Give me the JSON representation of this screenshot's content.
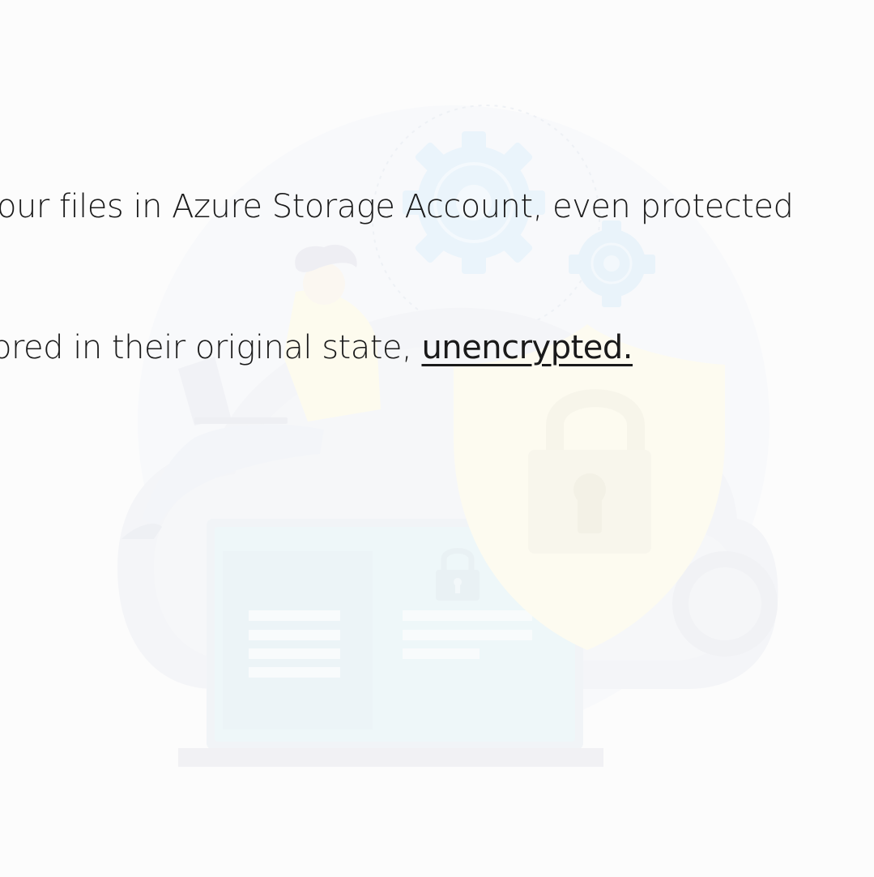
{
  "slide": {
    "line1": "our files in Azure Storage Account, even protected",
    "line2_prefix": "ored in their original state, ",
    "line2_emphasis": "unencrypted."
  },
  "illustration": {
    "icons": [
      "cloud-icon",
      "gear-icon",
      "shield-icon",
      "padlock-icon",
      "laptop-icon",
      "person-icon"
    ],
    "colors": {
      "cloud": "#f3f4f8",
      "gear": "#eaf4fb",
      "shield": "#fdfbf0",
      "laptop": "#eef6f9",
      "person_shirt": "#fdfbee",
      "hair": "#eeeef3"
    }
  }
}
